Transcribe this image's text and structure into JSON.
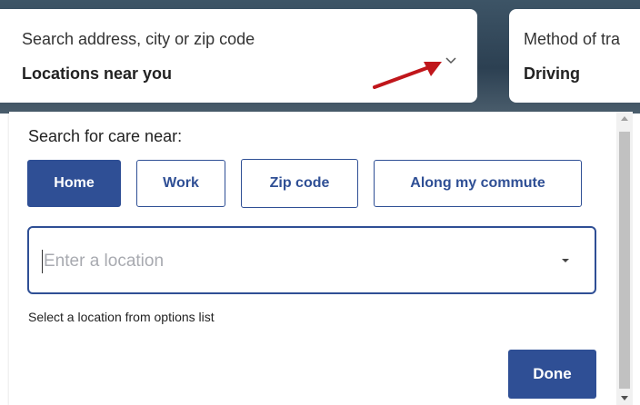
{
  "search_card": {
    "label": "Search address, city or zip code",
    "value": "Locations near you",
    "toggle_icon": "chevron-down-icon",
    "annotation_icon": "red-arrow-icon"
  },
  "method_card": {
    "label": "Method of tra",
    "value": "Driving"
  },
  "panel": {
    "title": "Search for care near:",
    "options": [
      {
        "label": "Home",
        "active": true
      },
      {
        "label": "Work",
        "active": false
      },
      {
        "label": "Zip code",
        "active": false
      },
      {
        "label": "Along my commute",
        "active": false
      }
    ],
    "location_input": {
      "value": "",
      "placeholder": "Enter a location",
      "icon": "caret-down-icon"
    },
    "helper_text": "Select a location from options list",
    "done_label": "Done"
  },
  "colors": {
    "primary": "#2f4f95",
    "annotation_arrow": "#c0161b"
  }
}
